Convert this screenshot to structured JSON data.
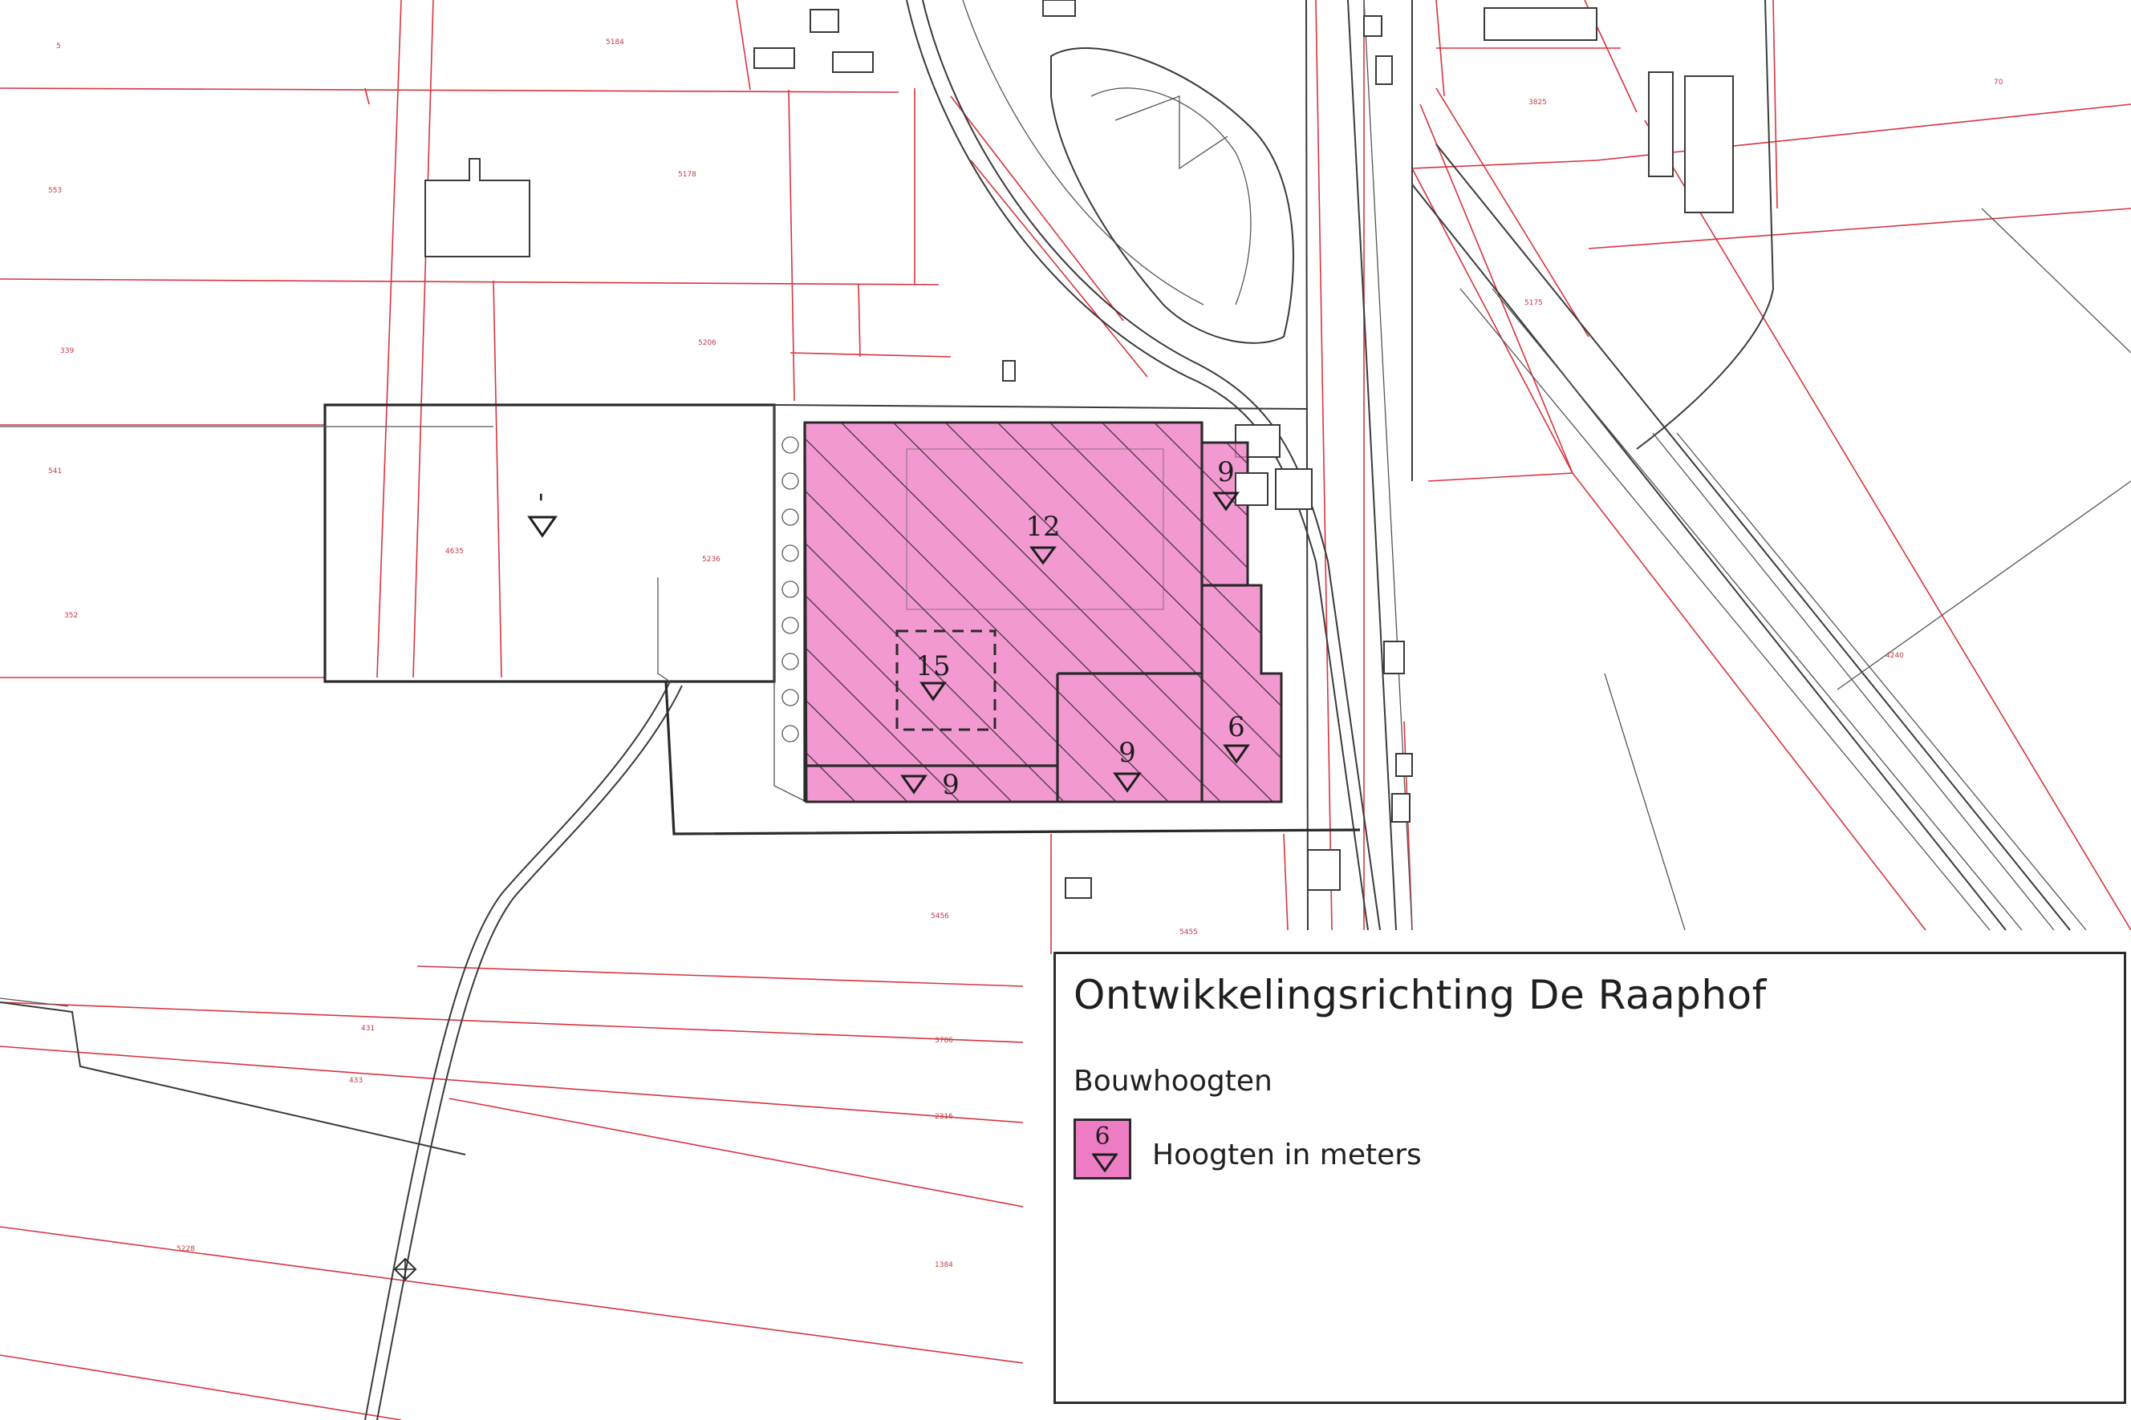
{
  "legend": {
    "title": "Ontwikkelingsrichting De Raaphof",
    "subtitle": "Bouwhoogten",
    "swatch_value": "6",
    "swatch_label": "Hoogten in meters"
  },
  "height_zones": [
    {
      "id": "zone-west",
      "value": "-"
    },
    {
      "id": "zone-main",
      "value": "12"
    },
    {
      "id": "zone-tower",
      "value": "15"
    },
    {
      "id": "zone-ne",
      "value": "9"
    },
    {
      "id": "zone-south-strip",
      "value": "9"
    },
    {
      "id": "zone-south-center",
      "value": "9"
    },
    {
      "id": "zone-se",
      "value": "6"
    }
  ],
  "colors": {
    "zone_fill": "#ee7cc4",
    "parcel_line": "#d8343f",
    "topo_line": "#3a3a3a"
  },
  "icons": {
    "height_marker": "triangle-down-icon",
    "survey_point": "diamond-cross-icon"
  }
}
